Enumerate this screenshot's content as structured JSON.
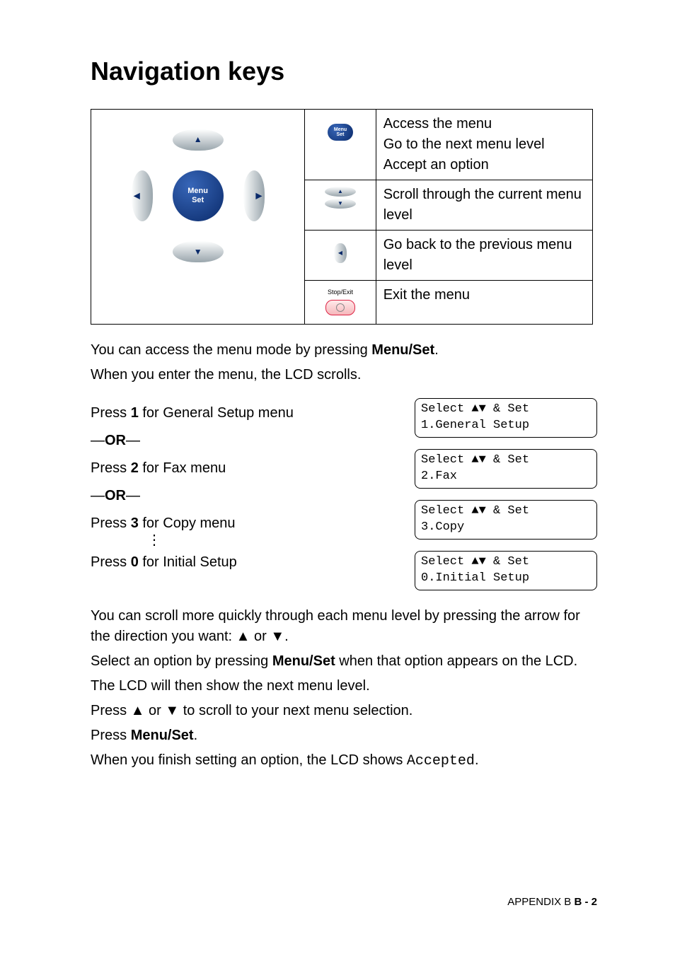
{
  "heading": "Navigation keys",
  "dpad": {
    "center_line1": "Menu",
    "center_line2": "Set"
  },
  "table": {
    "menu_icon": {
      "line1": "Menu",
      "line2": "Set"
    },
    "menu_desc_1": "Access the menu",
    "menu_desc_2": "Go to the next menu level",
    "menu_desc_3": "Accept an option",
    "updown_desc": "Scroll through the current menu level",
    "left_desc": "Go back to the previous menu level",
    "stop_label": "Stop/Exit",
    "stop_desc": "Exit the menu"
  },
  "para1_a": "You can access the menu mode by pressing ",
  "para1_b": "Menu/Set",
  "para1_c": ".",
  "para1_d": "When you enter the menu, the LCD scrolls.",
  "ors": {
    "p1_a": "Press ",
    "p1_b": "1",
    "p1_c": " for General Setup menu",
    "or": "—OR—",
    "p2_a": "Press ",
    "p2_b": "2",
    "p2_c": " for Fax menu",
    "p3_a": "Press ",
    "p3_b": "3",
    "p3_c": " for Copy menu",
    "p0_a": "Press ",
    "p0_b": "0",
    "p0_c": " for Initial Setup"
  },
  "vdots": "⋮",
  "lcd": {
    "l1": "Select ▲▼ & Set\n1.General Setup",
    "l2": "Select ▲▼ & Set\n2.Fax",
    "l3": "Select ▲▼ & Set\n3.Copy",
    "l4": "Select ▲▼ & Set\n0.Initial Setup"
  },
  "para2": "You can scroll more quickly through each menu level by pressing the arrow for the direction you want: ▲ or ▼.",
  "para3_a": "Select an option by pressing ",
  "para3_b": "Menu/Set",
  "para3_c": " when that option appears on the LCD.",
  "para4": "The LCD will then show the next menu level.",
  "para5": "Press ▲ or ▼ to scroll to your next menu selection.",
  "para6_a": "Press ",
  "para6_b": "Menu/Set",
  "para6_c": ".",
  "para7_a": "When you finish setting an option, the LCD shows ",
  "para7_mono": "Accepted",
  "para7_c": ".",
  "footer_a": "APPENDIX B   ",
  "footer_b": "B - 2"
}
